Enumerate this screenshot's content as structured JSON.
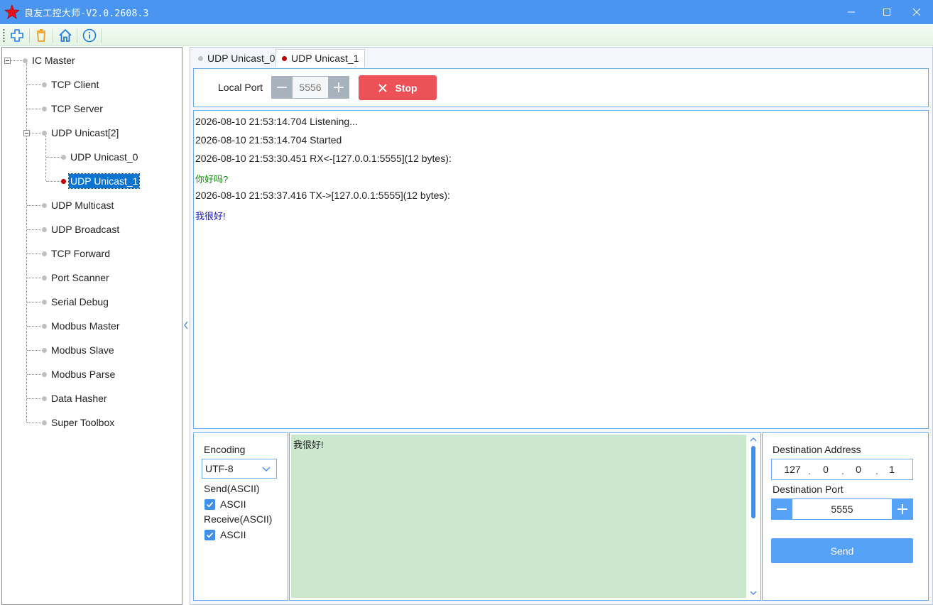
{
  "window": {
    "title": "良友工控大师-V2.0.2608.3",
    "brand_color": "#4a95f0",
    "icons": [
      "star-icon",
      "minimize-icon",
      "maximize-icon",
      "close-icon"
    ]
  },
  "toolbar": {
    "icons": [
      "add-icon",
      "delete-icon",
      "home-icon",
      "info-icon"
    ]
  },
  "tree": {
    "root": "IC Master",
    "items": [
      {
        "label": "TCP Client",
        "level": 1
      },
      {
        "label": "TCP Server",
        "level": 1
      },
      {
        "label": "UDP Unicast[2]",
        "level": 1
      },
      {
        "label": "UDP Unicast_0",
        "level": 2
      },
      {
        "label": "UDP Unicast_1",
        "level": 2,
        "selected": true
      },
      {
        "label": "UDP Multicast",
        "level": 1
      },
      {
        "label": "UDP Broadcast",
        "level": 1
      },
      {
        "label": "TCP Forward",
        "level": 1
      },
      {
        "label": "Port Scanner",
        "level": 1
      },
      {
        "label": "Serial Debug",
        "level": 1
      },
      {
        "label": "Modbus Master",
        "level": 1
      },
      {
        "label": "Modbus Slave",
        "level": 1
      },
      {
        "label": "Modbus Parse",
        "level": 1
      },
      {
        "label": "Data Hasher",
        "level": 1
      },
      {
        "label": "Super Toolbox",
        "level": 1
      }
    ]
  },
  "tabs": [
    {
      "label": "UDP Unicast_0",
      "active": false
    },
    {
      "label": "UDP Unicast_1",
      "active": true
    }
  ],
  "local": {
    "port_label": "Local Port",
    "port_value": "5556",
    "stop_label": "Stop",
    "stop_color": "#ec5158"
  },
  "log": [
    {
      "text": "2026-08-10 21:53:14.704 Listening...",
      "kind": "info"
    },
    {
      "text": "2026-08-10 21:53:14.704 Started",
      "kind": "info"
    },
    {
      "text": "2026-08-10 21:53:30.451 RX<-[127.0.0.1:5555](12 bytes):",
      "kind": "info"
    },
    {
      "text": "你好吗?",
      "kind": "rx"
    },
    {
      "text": "2026-08-10 21:53:37.416 TX->[127.0.0.1:5555](12 bytes):",
      "kind": "info"
    },
    {
      "text": "我很好!",
      "kind": "tx"
    }
  ],
  "options": {
    "encoding_label": "Encoding",
    "encoding_value": "UTF-8",
    "send_label": "Send(ASCII)",
    "send_check_label": "ASCII",
    "send_checked": true,
    "receive_label": "Receive(ASCII)",
    "receive_check_label": "ASCII",
    "receive_checked": true
  },
  "send_text": "我很好!",
  "destination": {
    "address_label": "Destination Address",
    "octets": [
      "127",
      "0",
      "0",
      "1"
    ],
    "port_label": "Destination Port",
    "port_value": "5555",
    "send_label": "Send"
  }
}
